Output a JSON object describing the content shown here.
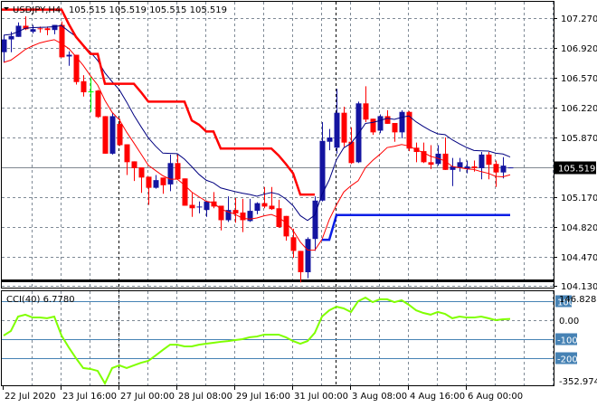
{
  "header": {
    "symbol": "USDJPY,H4",
    "ohlc": "105.515 105.519 105.515 105.519"
  },
  "indicator": {
    "label": "CCI(40) 6.7780"
  },
  "colors": {
    "bull": "#1414a0",
    "bear": "#ff0000",
    "doji": "#00ff00",
    "ma_high": "#000080",
    "ma_low": "#ff0000",
    "stop_red": "#ff0000",
    "stop_blue": "#0a1ee6",
    "cci": "#80ff00",
    "level": "#4682b4",
    "grid": "#7f8a96"
  },
  "chart_data": [
    {
      "type": "candlestick",
      "title": "USDJPY,H4",
      "price_axis": {
        "ticks": [
          "107.270",
          "106.920",
          "106.570",
          "106.220",
          "105.870",
          "105.519",
          "105.170",
          "104.820",
          "104.470",
          "104.130"
        ],
        "tick_values": [
          107.27,
          106.92,
          106.57,
          106.22,
          105.87,
          105.17,
          104.82,
          104.47,
          104.13
        ],
        "current": 105.519,
        "current_label": "105.519",
        "range": [
          104.07,
          107.46
        ]
      },
      "time_axis": {
        "ticks": [
          "22 Jul 2020",
          "23 Jul 16:00",
          "27 Jul 00:00",
          "28 Jul 08:00",
          "29 Jul 16:00",
          "31 Jul 00:00",
          "3 Aug 08:00",
          "4 Aug 16:00",
          "6 Aug 00:00"
        ],
        "tick_bar_index": [
          0,
          8,
          16,
          24,
          32,
          40,
          48,
          56,
          64
        ],
        "day_separators_bar_index": [
          16,
          46
        ]
      },
      "ohlc": [
        [
          106.87,
          107.07,
          106.75,
          107.02
        ],
        [
          107.02,
          107.11,
          106.87,
          107.06
        ],
        [
          107.05,
          107.22,
          107.05,
          107.18
        ],
        [
          107.18,
          107.29,
          107.13,
          107.14
        ],
        [
          107.11,
          107.19,
          107.09,
          107.14
        ],
        [
          107.15,
          107.17,
          107.1,
          107.14
        ],
        [
          107.15,
          107.17,
          107.07,
          107.13
        ],
        [
          107.13,
          107.19,
          107.08,
          107.19
        ],
        [
          107.19,
          107.23,
          106.81,
          106.81
        ],
        [
          106.82,
          106.88,
          106.71,
          106.84
        ],
        [
          106.84,
          106.84,
          106.49,
          106.52
        ],
        [
          106.53,
          106.6,
          106.35,
          106.4
        ],
        [
          106.41,
          106.58,
          106.17,
          106.41
        ],
        [
          106.42,
          106.43,
          106.1,
          106.11
        ],
        [
          106.12,
          106.12,
          105.68,
          105.68
        ],
        [
          105.68,
          106.16,
          105.67,
          106.12
        ],
        [
          106.03,
          106.09,
          105.77,
          105.78
        ],
        [
          105.79,
          105.79,
          105.43,
          105.58
        ],
        [
          105.59,
          105.59,
          105.36,
          105.51
        ],
        [
          105.52,
          105.52,
          105.22,
          105.4
        ],
        [
          105.41,
          105.41,
          105.08,
          105.28
        ],
        [
          105.28,
          105.43,
          105.27,
          105.37
        ],
        [
          105.4,
          105.4,
          105.21,
          105.31
        ],
        [
          105.32,
          105.67,
          105.24,
          105.57
        ],
        [
          105.57,
          105.67,
          105.38,
          105.38
        ],
        [
          105.39,
          105.39,
          105.07,
          105.07
        ],
        [
          105.08,
          105.22,
          104.94,
          105.04
        ],
        [
          105.05,
          105.12,
          104.98,
          105.06
        ],
        [
          105.02,
          105.13,
          104.94,
          105.12
        ],
        [
          105.12,
          105.23,
          105.04,
          105.06
        ],
        [
          105.07,
          105.07,
          104.78,
          104.9
        ],
        [
          104.9,
          105.18,
          104.88,
          105.02
        ],
        [
          105.02,
          105.16,
          104.87,
          104.98
        ],
        [
          104.99,
          105.15,
          104.76,
          104.9
        ],
        [
          104.89,
          105.15,
          104.88,
          105.01
        ],
        [
          105.01,
          105.11,
          104.97,
          105.1
        ],
        [
          105.1,
          105.29,
          105.04,
          105.06
        ],
        [
          105.07,
          105.29,
          105.02,
          105.03
        ],
        [
          105.04,
          105.14,
          104.81,
          104.82
        ],
        [
          104.95,
          104.95,
          104.66,
          104.71
        ],
        [
          104.7,
          104.8,
          104.46,
          104.54
        ],
        [
          104.54,
          104.54,
          104.17,
          104.29
        ],
        [
          104.29,
          104.7,
          104.22,
          104.68
        ],
        [
          104.68,
          105.18,
          104.54,
          105.13
        ],
        [
          105.13,
          106.05,
          105.12,
          105.83
        ],
        [
          105.82,
          105.97,
          105.72,
          105.87
        ],
        [
          105.75,
          106.44,
          105.68,
          106.16
        ],
        [
          106.16,
          106.23,
          105.76,
          105.81
        ],
        [
          105.82,
          105.99,
          105.56,
          105.57
        ],
        [
          105.58,
          106.29,
          105.57,
          106.27
        ],
        [
          106.27,
          106.47,
          106.05,
          106.08
        ],
        [
          106.09,
          106.09,
          105.9,
          105.93
        ],
        [
          105.95,
          106.14,
          105.92,
          106.12
        ],
        [
          106.12,
          106.19,
          106.03,
          106.03
        ],
        [
          106.04,
          106.04,
          105.82,
          105.93
        ],
        [
          105.93,
          106.19,
          105.86,
          106.17
        ],
        [
          106.17,
          106.18,
          105.71,
          105.74
        ],
        [
          105.75,
          105.81,
          105.58,
          105.7
        ],
        [
          105.71,
          105.81,
          105.57,
          105.58
        ],
        [
          105.58,
          105.78,
          105.5,
          105.55
        ],
        [
          105.56,
          105.78,
          105.54,
          105.68
        ],
        [
          105.68,
          105.87,
          105.49,
          105.49
        ],
        [
          105.49,
          105.63,
          105.3,
          105.53
        ],
        [
          105.52,
          105.63,
          105.47,
          105.58
        ],
        [
          105.5,
          105.6,
          105.45,
          105.53
        ],
        [
          105.53,
          105.6,
          105.47,
          105.51
        ],
        [
          105.51,
          105.7,
          105.38,
          105.67
        ],
        [
          105.67,
          105.7,
          105.38,
          105.55
        ],
        [
          105.56,
          105.6,
          105.29,
          105.46
        ],
        [
          105.46,
          105.64,
          105.39,
          105.54
        ],
        [
          105.515,
          105.519,
          105.515,
          105.519
        ]
      ],
      "stop_red": [
        107.37,
        107.37,
        107.37,
        107.37,
        107.37,
        107.37,
        107.37,
        107.37,
        107.37,
        107.2,
        107.05,
        106.95,
        106.85,
        106.85,
        106.5,
        106.5,
        106.5,
        106.5,
        106.5,
        106.4,
        106.29,
        106.29,
        106.29,
        106.29,
        106.29,
        106.29,
        106.07,
        106.02,
        105.94,
        105.94,
        105.74,
        105.74,
        105.74,
        105.74,
        105.74,
        105.74,
        105.74,
        105.74,
        105.66,
        105.56,
        105.45,
        105.2,
        105.2,
        105.2
      ],
      "stop_blue_start_index": 44,
      "stop_blue": [
        104.67,
        104.67,
        104.96,
        104.96,
        104.96,
        104.96,
        104.96,
        104.96,
        104.96,
        104.96,
        104.96,
        104.96,
        104.96,
        104.96,
        104.96,
        104.96,
        104.96,
        104.96,
        104.96,
        104.96,
        104.96,
        104.96,
        104.96,
        104.96,
        104.96,
        104.96,
        104.96
      ],
      "horizontal_line": 104.19
    },
    {
      "type": "line",
      "title": "CCI(40) 6.7780",
      "range": [
        -352.9742,
        146.8289
      ],
      "range_labels": [
        "146.8289",
        "-352.9742"
      ],
      "levels": [
        100,
        -100,
        -200
      ],
      "level_labels": [
        "100",
        "-100",
        "-200"
      ],
      "zero_label": "0.00",
      "values": [
        -81,
        -57,
        19,
        29,
        14,
        14,
        10,
        19,
        -81,
        -143,
        -200,
        -252,
        -257,
        -267,
        -333,
        -252,
        -238,
        -252,
        -238,
        -224,
        -214,
        -186,
        -157,
        -129,
        -129,
        -138,
        -138,
        -129,
        -124,
        -119,
        -114,
        -110,
        -105,
        -100,
        -90,
        -86,
        -76,
        -76,
        -76,
        -90,
        -110,
        -124,
        -110,
        -67,
        19,
        52,
        71,
        62,
        43,
        100,
        119,
        95,
        110,
        110,
        95,
        105,
        81,
        52,
        38,
        29,
        43,
        33,
        10,
        19,
        14,
        14,
        19,
        10,
        0,
        5,
        6.778
      ]
    }
  ]
}
